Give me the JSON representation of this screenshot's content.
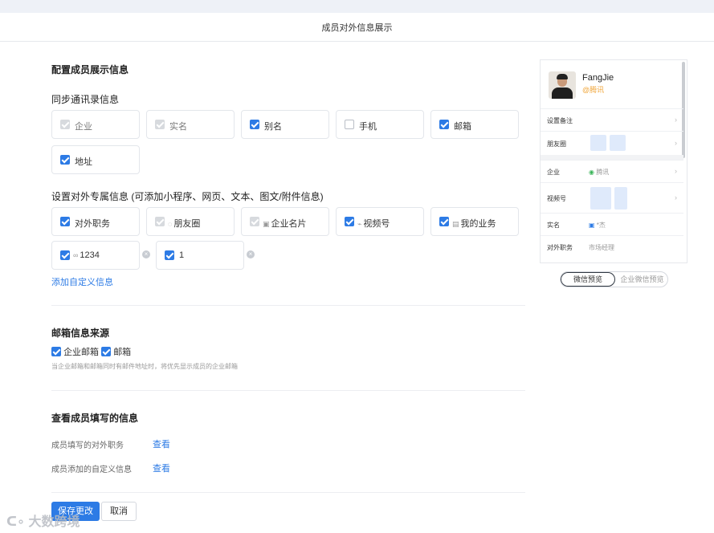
{
  "header": {
    "title": "成员对外信息展示"
  },
  "config": {
    "heading": "配置成员展示信息",
    "sync_heading": "同步通讯录信息",
    "sync_items": [
      {
        "label": "企业",
        "state": "disabled"
      },
      {
        "label": "实名",
        "state": "disabled"
      },
      {
        "label": "别名",
        "state": "checked"
      },
      {
        "label": "手机",
        "state": "unchecked"
      },
      {
        "label": "邮箱",
        "state": "checked"
      },
      {
        "label": "地址",
        "state": "checked"
      }
    ],
    "external_heading": "设置对外专属信息 (可添加小程序、网页、文本、图文/附件信息)",
    "external_items": [
      {
        "label": "对外职务",
        "state": "checked",
        "icon": ""
      },
      {
        "label": "朋友圈",
        "state": "disabled",
        "icon": "moments-icon"
      },
      {
        "label": "企业名片",
        "state": "disabled",
        "icon": "card-icon"
      },
      {
        "label": "视频号",
        "state": "checked",
        "icon": "video-icon"
      },
      {
        "label": "我的业务",
        "state": "checked",
        "icon": "business-icon"
      }
    ],
    "custom_items": [
      {
        "label": "1234",
        "state": "checked",
        "icon": "link-icon"
      },
      {
        "label": "1",
        "state": "checked",
        "icon": ""
      }
    ],
    "add_custom_link": "添加自定义信息"
  },
  "email": {
    "heading": "邮箱信息来源",
    "corp_label": "企业邮箱",
    "mail_label": "邮箱",
    "note": "当企业邮箱和邮箱同时有邮件地址时，将优先显示成员的企业邮箱"
  },
  "member_info": {
    "heading": "查看成员填写的信息",
    "rows": [
      {
        "label": "成员填写的对外职务",
        "action": "查看"
      },
      {
        "label": "成员添加的自定义信息",
        "action": "查看"
      }
    ]
  },
  "footer": {
    "save": "保存更改",
    "cancel": "取消"
  },
  "preview": {
    "name": "FangJie",
    "corp": "@腾讯",
    "rows": {
      "remark": "设置备注",
      "moments": "朋友圈",
      "corp_label": "企业",
      "corp_value": "腾讯",
      "video": "视频号",
      "realname_label": "实名",
      "realname_value": "*杰",
      "position_label": "对外职务",
      "position_value": "市场经理"
    },
    "tabs": {
      "wechat": "微信预览",
      "wecom": "企业微信预览"
    }
  },
  "watermark": "大数跨境",
  "colors": {
    "accent": "#2d7be5",
    "warning": "#f0a63a"
  }
}
